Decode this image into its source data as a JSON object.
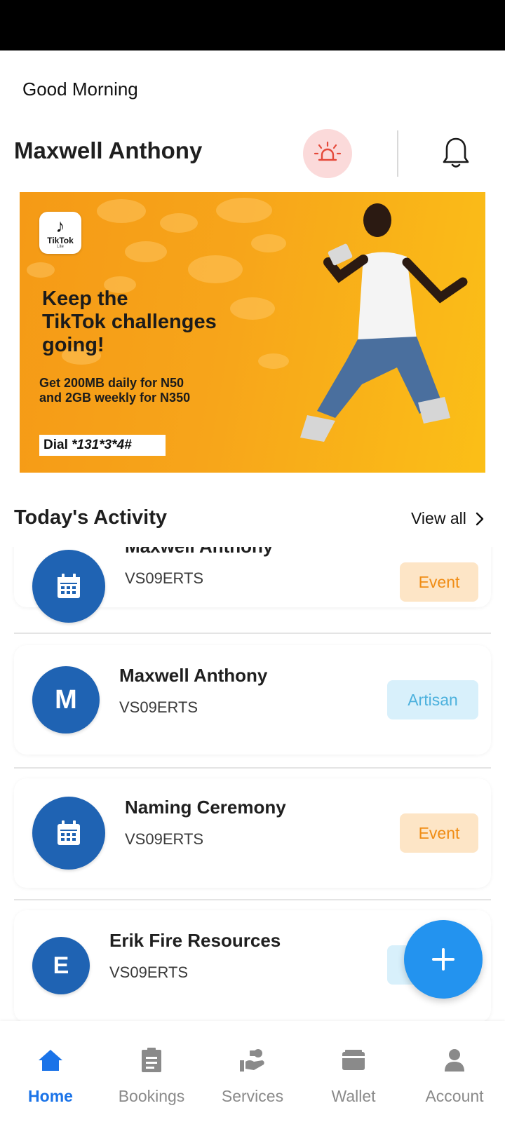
{
  "header": {
    "greeting": "Good Morning",
    "user_name": "Maxwell Anthony"
  },
  "banner": {
    "logo_name": "TikTok",
    "logo_sub": "Lite",
    "headline_1": "Keep the",
    "headline_2": "TikTok challenges",
    "headline_3": "going!",
    "offer_1": "Get 200MB daily for N50",
    "offer_2": "and 2GB weekly for N350",
    "dial_prefix": "Dial ",
    "dial_code": "*131*3*4#"
  },
  "activity": {
    "title": "Today's Activity",
    "view_all": "View all",
    "items": [
      {
        "title": "Maxwell Anthony",
        "code": "VS09ERTS",
        "badge": "Event",
        "avatar": ""
      },
      {
        "title": "Maxwell Anthony",
        "code": "VS09ERTS",
        "badge": "Artisan",
        "avatar": "M"
      },
      {
        "title": "Naming Ceremony",
        "code": "VS09ERTS",
        "badge": "Event",
        "avatar": ""
      },
      {
        "title": "Erik Fire Resources",
        "code": "VS09ERTS",
        "badge": "",
        "avatar": "E"
      }
    ]
  },
  "nav": {
    "items": [
      {
        "label": "Home",
        "icon": "home-icon"
      },
      {
        "label": "Bookings",
        "icon": "clipboard-icon"
      },
      {
        "label": "Services",
        "icon": "services-icon"
      },
      {
        "label": "Wallet",
        "icon": "wallet-icon"
      },
      {
        "label": "Account",
        "icon": "person-icon"
      }
    ],
    "active": "Home"
  },
  "colors": {
    "primary": "#1f63b3",
    "fab": "#2393ef",
    "active_nav": "#1a73e8",
    "event_badge_bg": "#fde5c6",
    "event_badge_text": "#f08c14",
    "artisan_badge_bg": "#d8f0fb",
    "artisan_badge_text": "#4cb1dd",
    "alarm_bg": "#fbdada",
    "alarm_icon": "#e5493a"
  }
}
